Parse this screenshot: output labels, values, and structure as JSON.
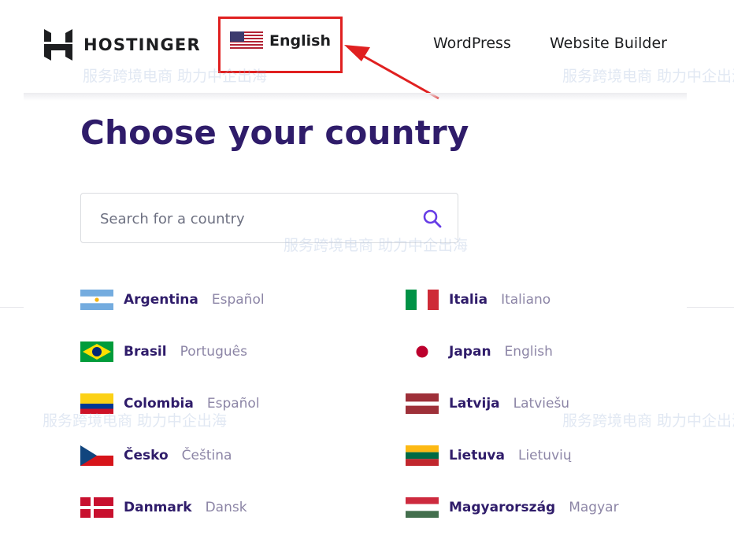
{
  "header": {
    "brand": "HOSTINGER",
    "language_button": {
      "label": "English",
      "flag": "us-flag-icon"
    },
    "nav": [
      {
        "label": "WordPress"
      },
      {
        "label": "Website Builder"
      }
    ]
  },
  "page": {
    "title": "Choose your country",
    "search": {
      "placeholder": "Search for a country",
      "value": ""
    }
  },
  "countries": {
    "left": [
      {
        "name": "Argentina",
        "language": "Español",
        "flag": "argentina-flag-icon"
      },
      {
        "name": "Brasil",
        "language": "Português",
        "flag": "brazil-flag-icon"
      },
      {
        "name": "Colombia",
        "language": "Español",
        "flag": "colombia-flag-icon"
      },
      {
        "name": "Česko",
        "language": "Čeština",
        "flag": "czech-flag-icon"
      },
      {
        "name": "Danmark",
        "language": "Dansk",
        "flag": "denmark-flag-icon"
      }
    ],
    "right": [
      {
        "name": "Italia",
        "language": "Italiano",
        "flag": "italy-flag-icon"
      },
      {
        "name": "Japan",
        "language": "English",
        "flag": "japan-flag-icon"
      },
      {
        "name": "Latvija",
        "language": "Latviešu",
        "flag": "latvia-flag-icon"
      },
      {
        "name": "Lietuva",
        "language": "Lietuvių",
        "flag": "lithuania-flag-icon"
      },
      {
        "name": "Magyarország",
        "language": "Magyar",
        "flag": "hungary-flag-icon"
      }
    ]
  },
  "watermark": {
    "text": "服务跨境电商 助力中企出海"
  },
  "colors": {
    "brand_purple": "#2f1c6a",
    "highlight_red": "#e02020",
    "search_icon": "#673de6",
    "muted_language": "#8c85a6"
  }
}
